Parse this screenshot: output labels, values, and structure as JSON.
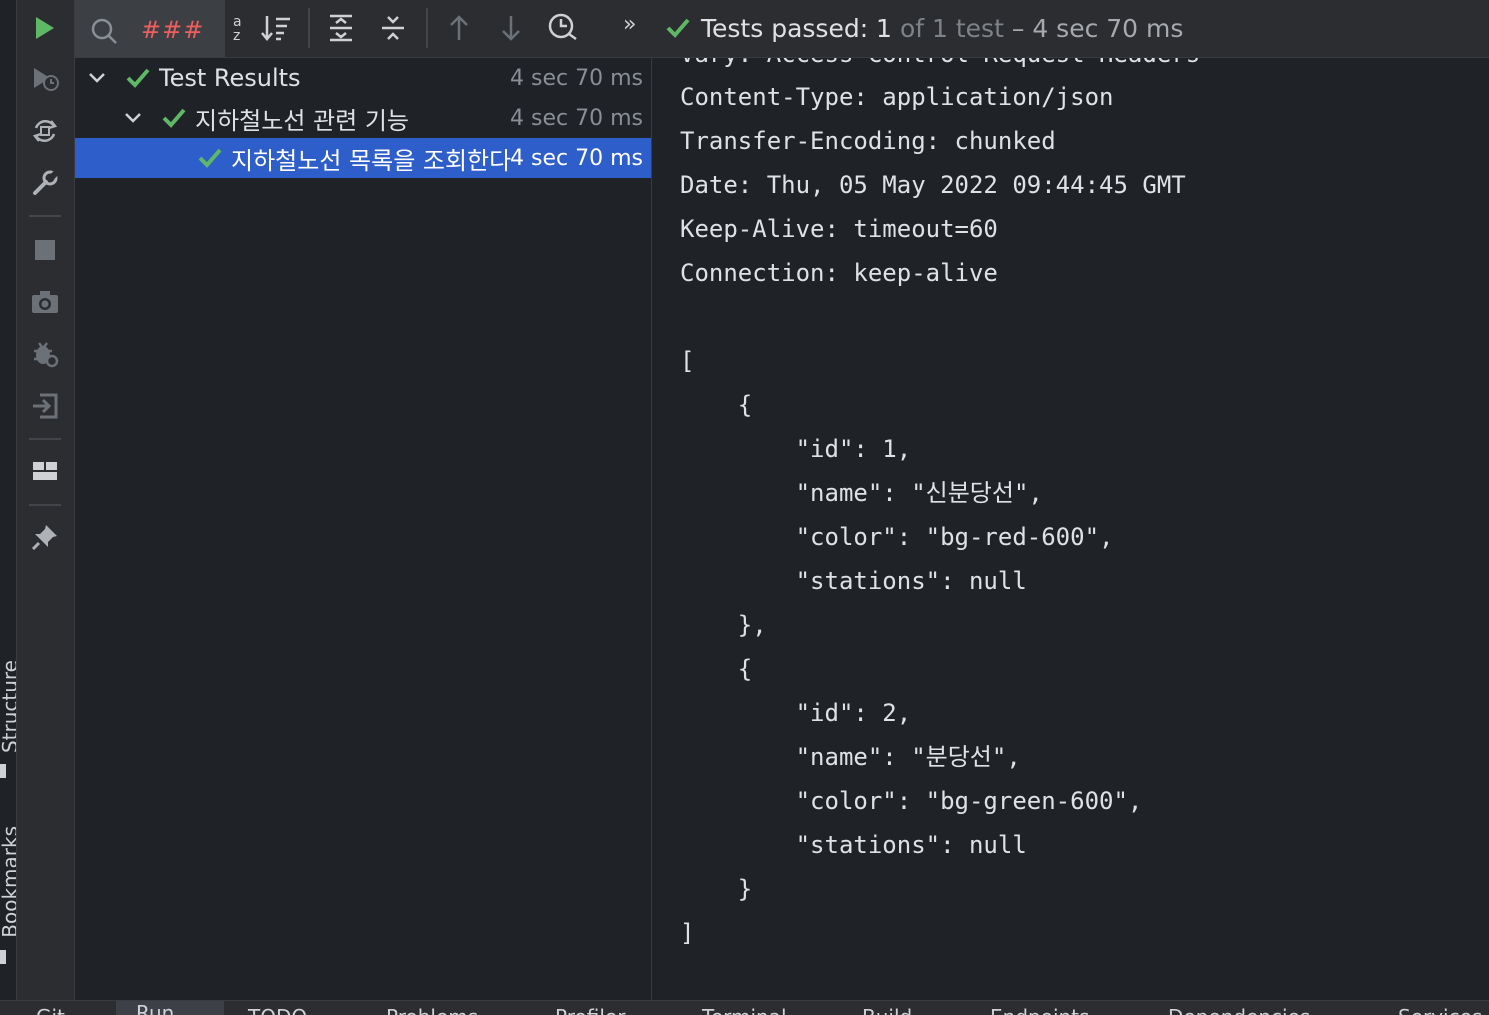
{
  "side_labels": {
    "structure": "Structure",
    "bookmarks": "Bookmarks"
  },
  "vertical_toolbar": [
    {
      "name": "run-icon",
      "color": "#5fb865"
    },
    {
      "name": "rerun-failed-icon"
    },
    {
      "name": "toggle-auto-test-icon"
    },
    {
      "name": "wrench-icon"
    },
    {
      "name": "stop-icon"
    },
    {
      "name": "camera-icon"
    },
    {
      "name": "debug-settings-icon"
    },
    {
      "name": "exit-icon"
    },
    {
      "name": "layout-icon"
    },
    {
      "name": "pin-icon"
    }
  ],
  "toolbar": {
    "search_value": "###",
    "status_ok": "Tests passed: 1",
    "status_dim": "of 1 test",
    "status_duration": "– 4 sec 70 ms"
  },
  "tree": {
    "rows": [
      {
        "label": "Test Results",
        "duration": "4 sec 70 ms"
      },
      {
        "label": "지하철노선 관련 기능",
        "duration": "4 sec 70 ms"
      },
      {
        "label": "지하철노선 목록을 조회한다",
        "duration": "4 sec 70 ms"
      }
    ]
  },
  "console": {
    "lines": [
      "Vary: Access-Control-Request-Headers",
      "Content-Type: application/json",
      "Transfer-Encoding: chunked",
      "Date: Thu, 05 May 2022 09:44:45 GMT",
      "Keep-Alive: timeout=60",
      "Connection: keep-alive",
      "",
      "[",
      "    {",
      "        \"id\": 1,",
      "        \"name\": \"신분당선\",",
      "        \"color\": \"bg-red-600\",",
      "        \"stations\": null",
      "    },",
      "    {",
      "        \"id\": 2,",
      "        \"name\": \"분당선\",",
      "        \"color\": \"bg-green-600\",",
      "        \"stations\": null",
      "    }",
      "]"
    ]
  },
  "bottom_tabs": [
    "Git",
    "Run",
    "TODO",
    "Problems",
    "Profiler",
    "Terminal",
    "Build",
    "Endpoints",
    "Dependencies",
    "Services"
  ],
  "colors": {
    "accent_green": "#5fb865",
    "selection": "#2e5ec9",
    "search_text": "#ed5e5e"
  }
}
